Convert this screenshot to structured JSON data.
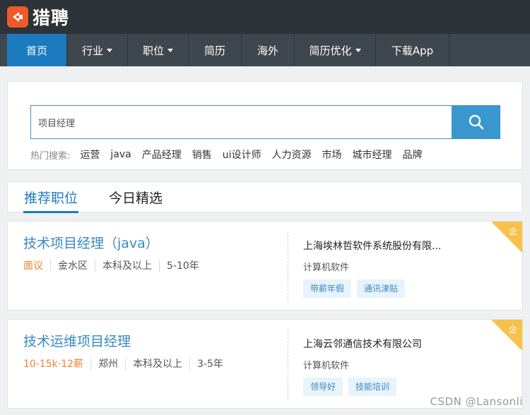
{
  "brand": {
    "name": "猎聘",
    "logo_icon": "liepin-logo-icon",
    "logo_color": "#ef5a28"
  },
  "nav": {
    "items": [
      {
        "label": "首页",
        "dropdown": false,
        "active": true
      },
      {
        "label": "行业",
        "dropdown": true,
        "active": false
      },
      {
        "label": "职位",
        "dropdown": true,
        "active": false
      },
      {
        "label": "简历",
        "dropdown": false,
        "active": false
      },
      {
        "label": "海外",
        "dropdown": false,
        "active": false
      },
      {
        "label": "简历优化",
        "dropdown": true,
        "active": false
      },
      {
        "label": "下载App",
        "dropdown": false,
        "active": false
      }
    ]
  },
  "search": {
    "value": "项目经理",
    "button_icon": "search-icon",
    "hot_label": "热门搜索:",
    "hot_words": [
      "运营",
      "java",
      "产品经理",
      "销售",
      "ui设计师",
      "人力资源",
      "市场",
      "城市经理",
      "品牌"
    ]
  },
  "tabs": [
    {
      "label": "推荐职位",
      "active": true
    },
    {
      "label": "今日精选",
      "active": false
    }
  ],
  "jobs": [
    {
      "title": "技术项目经理（java）",
      "salary": "面议",
      "location": "金水区",
      "education": "本科及以上",
      "experience": "5-10年",
      "company": "上海埃林哲软件系统股份有限...",
      "industry": "计算机软件",
      "tags": [
        "带薪年假",
        "通讯津贴"
      ],
      "badge": "企"
    },
    {
      "title": "技术运维项目经理",
      "salary": "10-15k·12薪",
      "location": "郑州",
      "education": "本科及以上",
      "experience": "3-5年",
      "company": "上海云邻通信技术有限公司",
      "industry": "计算机软件",
      "tags": [
        "领导好",
        "技能培训"
      ],
      "badge": "企"
    }
  ],
  "colors": {
    "topbar": "#2d3339",
    "nav": "#3e464e",
    "active_blue": "#1c7bbf",
    "link_blue": "#3a89c2",
    "salary_orange": "#f2822b",
    "badge_yellow": "#f7c14b"
  },
  "watermark": "CSDN @Lansonli"
}
